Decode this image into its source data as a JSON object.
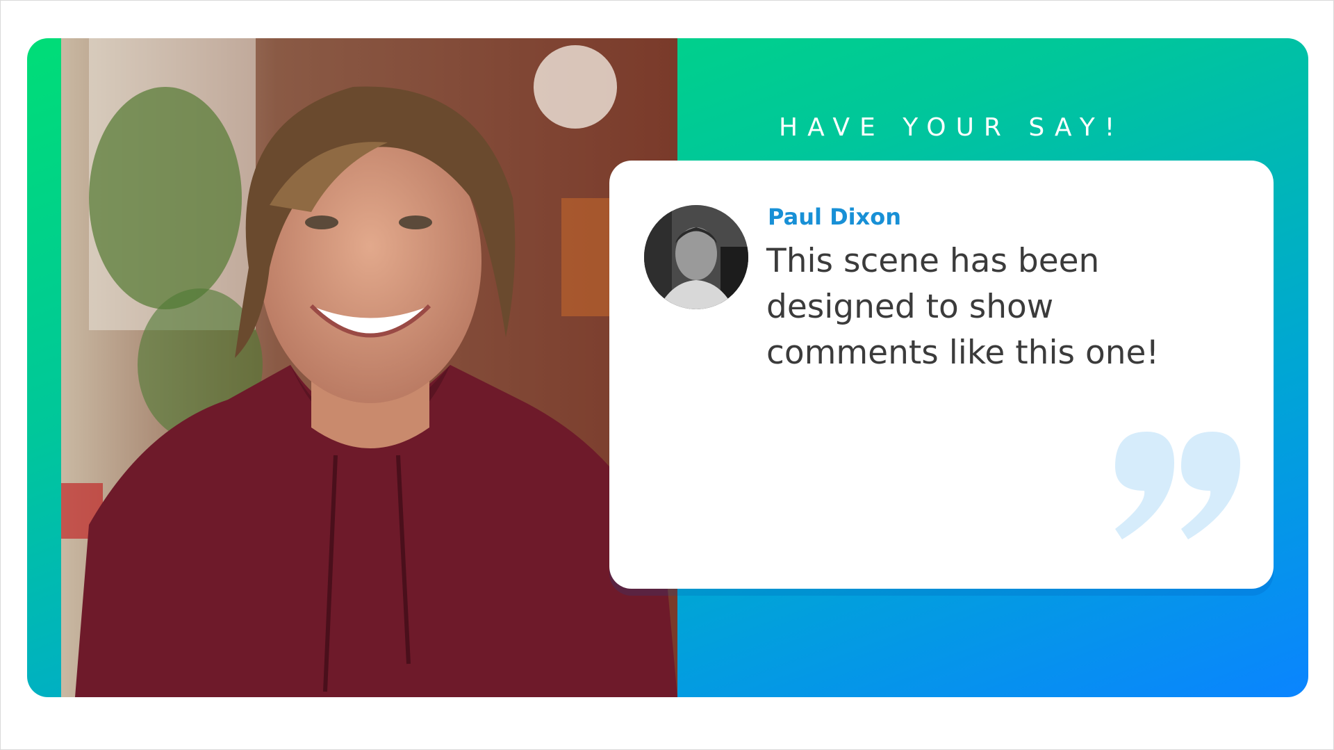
{
  "scene": {
    "heading": "HAVE YOUR SAY!",
    "comment": {
      "author": "Paul Dixon",
      "text": "This scene has been designed to show comments like this one!"
    }
  },
  "icons": {
    "quote": "closing-quote-icon",
    "avatar": "user-avatar-photo"
  },
  "colors": {
    "gradient_top": "#00dd77",
    "gradient_bottom": "#0a84ff",
    "author": "#1890d6",
    "comment_text": "#3b3b3b",
    "quote_mark": "#d6ecfb"
  }
}
